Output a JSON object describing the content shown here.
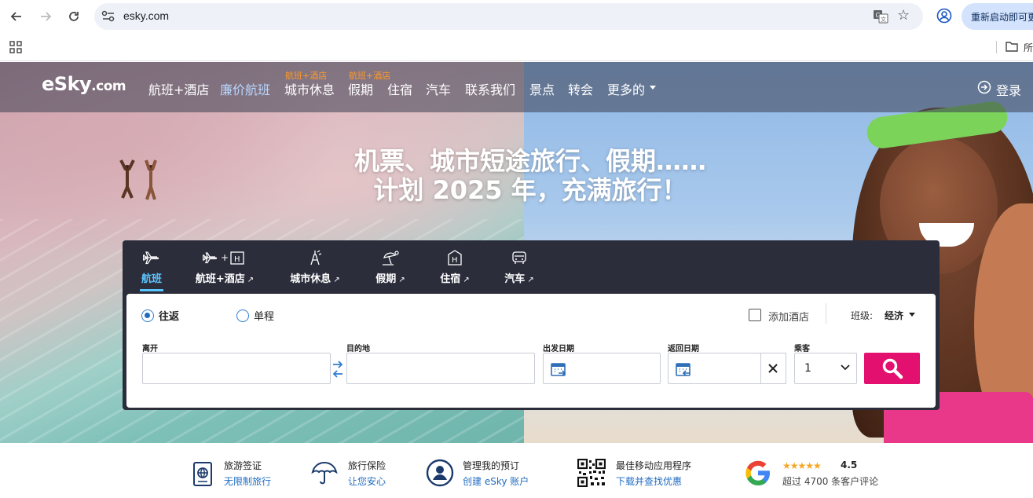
{
  "browser": {
    "url": "esky.com",
    "update_button": "重新启动即可更",
    "bookmarks_folder": "所"
  },
  "site_nav": {
    "logo_main": "eSky",
    "logo_suffix": ".com",
    "items": [
      {
        "label": "航班+酒店",
        "badge": ""
      },
      {
        "label": "廉价航班",
        "badge": ""
      },
      {
        "label": "城市休息",
        "badge": "航班+酒店"
      },
      {
        "label": "假期",
        "badge": "航班+酒店"
      },
      {
        "label": "住宿",
        "badge": ""
      },
      {
        "label": "汽车",
        "badge": ""
      },
      {
        "label": "联系我们",
        "badge": ""
      },
      {
        "label": "景点",
        "badge": ""
      },
      {
        "label": "转会",
        "badge": ""
      },
      {
        "label": "更多的",
        "badge": ""
      }
    ],
    "login": "登录"
  },
  "hero": {
    "headline_line1": "机票、城市短途旅行、假期……",
    "headline_line2": "计划 2025 年，充满旅行！"
  },
  "search_tabs": [
    {
      "label": "航班",
      "icon": "plane-icon",
      "active": true,
      "external": false
    },
    {
      "label": "航班+酒店",
      "icon": "plane-hotel-icon",
      "active": false,
      "external": true
    },
    {
      "label": "城市休息",
      "icon": "eiffel-tower-icon",
      "active": false,
      "external": true
    },
    {
      "label": "假期",
      "icon": "beach-umbrella-icon",
      "active": false,
      "external": true
    },
    {
      "label": "住宿",
      "icon": "hotel-icon",
      "active": false,
      "external": true
    },
    {
      "label": "汽车",
      "icon": "car-icon",
      "active": false,
      "external": true
    }
  ],
  "search_form": {
    "trip_type": {
      "round_trip": "往返",
      "one_way": "单程",
      "selected": "往返"
    },
    "add_hotel_label": "添加酒店",
    "add_hotel_checked": false,
    "class_label": "班级:",
    "class_value": "经济",
    "fields": {
      "from_label": "离开",
      "from_value": "",
      "to_label": "目的地",
      "to_value": "",
      "depart_label": "出发日期",
      "depart_value": "",
      "return_label": "返回日期",
      "return_value": "",
      "passengers_label": "乘客",
      "passengers_value": "1"
    }
  },
  "features": [
    {
      "title": "旅游签证",
      "subtitle": "无限制旅行",
      "icon": "passport-icon"
    },
    {
      "title": "旅行保险",
      "subtitle": "让您安心",
      "icon": "umbrella-icon"
    },
    {
      "title": "管理我的预订",
      "subtitle": "创建 eSky 账户",
      "icon": "user-account-icon"
    },
    {
      "title": "最佳移动应用程序",
      "subtitle": "下载并查找优惠",
      "icon": "qr-code-icon"
    }
  ],
  "reviews": {
    "stars": "★★★★★",
    "rating": "4.5",
    "text": "超过 4700 条客户评论",
    "icon": "google-icon"
  },
  "colors": {
    "brand_pink": "#e3106f",
    "accent_blue": "#5bc4ff",
    "badge_orange": "#ff9a2a",
    "link_blue": "#1f6cc3",
    "widget_dark": "#2b2d3b"
  }
}
